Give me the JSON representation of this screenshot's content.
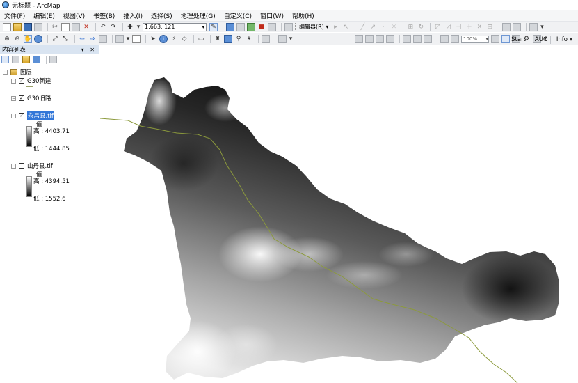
{
  "window": {
    "title": "无标题 - ArcMap"
  },
  "menu": {
    "items": [
      {
        "label": "文件(F)"
      },
      {
        "label": "编辑(E)"
      },
      {
        "label": "视图(V)"
      },
      {
        "label": "书签(B)"
      },
      {
        "label": "插入(I)"
      },
      {
        "label": "选择(S)"
      },
      {
        "label": "地理处理(G)"
      },
      {
        "label": "自定义(C)"
      },
      {
        "label": "窗口(W)"
      },
      {
        "label": "帮助(H)"
      }
    ]
  },
  "toolbar": {
    "scale": "1:663, 121",
    "editor_label": "编辑器(R) ▾",
    "zoom_value": "100%",
    "right_labels": [
      "Start",
      "AUC",
      "Info"
    ]
  },
  "toc": {
    "title": "内容列表",
    "controls": "▾ ✕",
    "root_label": "图层",
    "layers": [
      {
        "name": "G30新建",
        "checked": true
      },
      {
        "name": "G30旧路",
        "checked": true
      },
      {
        "name": "永昌县.tif",
        "checked": true,
        "value_label": "值",
        "high": "高 : 4403.71",
        "low": "低 : 1444.85"
      },
      {
        "name": "山丹县.tif",
        "checked": false,
        "value_label": "值",
        "high": "高 : 4394.51",
        "low": "低 : 1552.6"
      }
    ]
  },
  "colors": {
    "selection": "#3377d8",
    "road_line": "#8c9a3c",
    "toc_header": "#d9e4f1"
  }
}
